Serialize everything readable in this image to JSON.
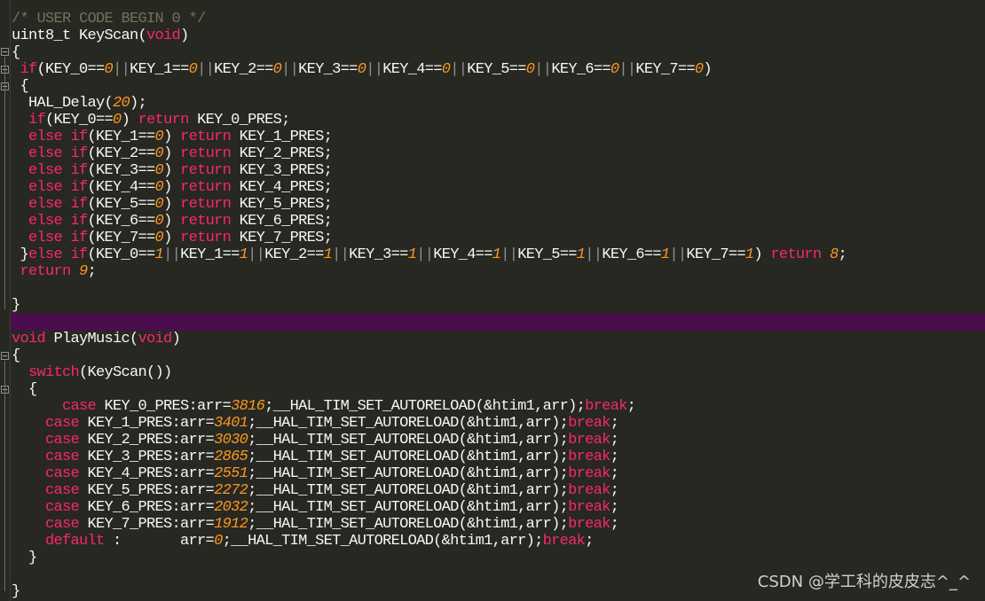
{
  "editor": {
    "lines": [
      [
        {
          "t": "/* USER CODE BEGIN 0 */",
          "c": "cm"
        }
      ],
      [
        {
          "t": "uint8_t KeyScan(",
          "c": "pl"
        },
        {
          "t": "void",
          "c": "kw"
        },
        {
          "t": ")",
          "c": "pl"
        }
      ],
      [
        {
          "t": "{",
          "c": "pl"
        }
      ],
      [
        {
          "t": " ",
          "c": "pl"
        },
        {
          "t": "if",
          "c": "kw"
        },
        {
          "t": "(KEY_0==",
          "c": "pl"
        },
        {
          "t": "0",
          "c": "num"
        },
        {
          "t": "||",
          "c": "sep"
        },
        {
          "t": "KEY_1==",
          "c": "pl"
        },
        {
          "t": "0",
          "c": "num"
        },
        {
          "t": "||",
          "c": "sep"
        },
        {
          "t": "KEY_2==",
          "c": "pl"
        },
        {
          "t": "0",
          "c": "num"
        },
        {
          "t": "||",
          "c": "sep"
        },
        {
          "t": "KEY_3==",
          "c": "pl"
        },
        {
          "t": "0",
          "c": "num"
        },
        {
          "t": "||",
          "c": "sep"
        },
        {
          "t": "KEY_4==",
          "c": "pl"
        },
        {
          "t": "0",
          "c": "num"
        },
        {
          "t": "||",
          "c": "sep"
        },
        {
          "t": "KEY_5==",
          "c": "pl"
        },
        {
          "t": "0",
          "c": "num"
        },
        {
          "t": "||",
          "c": "sep"
        },
        {
          "t": "KEY_6==",
          "c": "pl"
        },
        {
          "t": "0",
          "c": "num"
        },
        {
          "t": "||",
          "c": "sep"
        },
        {
          "t": "KEY_7==",
          "c": "pl"
        },
        {
          "t": "0",
          "c": "num"
        },
        {
          "t": ")",
          "c": "pl"
        }
      ],
      [
        {
          "t": " {",
          "c": "pl"
        }
      ],
      [
        {
          "t": "  HAL_Delay(",
          "c": "pl"
        },
        {
          "t": "20",
          "c": "num"
        },
        {
          "t": ");",
          "c": "pl"
        }
      ],
      [
        {
          "t": "  ",
          "c": "pl"
        },
        {
          "t": "if",
          "c": "kw"
        },
        {
          "t": "(KEY_0==",
          "c": "pl"
        },
        {
          "t": "0",
          "c": "num"
        },
        {
          "t": ") ",
          "c": "pl"
        },
        {
          "t": "return",
          "c": "kw"
        },
        {
          "t": " KEY_0_PRES;",
          "c": "pl"
        }
      ],
      [
        {
          "t": "  ",
          "c": "pl"
        },
        {
          "t": "else if",
          "c": "kw"
        },
        {
          "t": "(KEY_1==",
          "c": "pl"
        },
        {
          "t": "0",
          "c": "num"
        },
        {
          "t": ") ",
          "c": "pl"
        },
        {
          "t": "return",
          "c": "kw"
        },
        {
          "t": " KEY_1_PRES;",
          "c": "pl"
        }
      ],
      [
        {
          "t": "  ",
          "c": "pl"
        },
        {
          "t": "else if",
          "c": "kw"
        },
        {
          "t": "(KEY_2==",
          "c": "pl"
        },
        {
          "t": "0",
          "c": "num"
        },
        {
          "t": ") ",
          "c": "pl"
        },
        {
          "t": "return",
          "c": "kw"
        },
        {
          "t": " KEY_2_PRES;",
          "c": "pl"
        }
      ],
      [
        {
          "t": "  ",
          "c": "pl"
        },
        {
          "t": "else if",
          "c": "kw"
        },
        {
          "t": "(KEY_3==",
          "c": "pl"
        },
        {
          "t": "0",
          "c": "num"
        },
        {
          "t": ") ",
          "c": "pl"
        },
        {
          "t": "return",
          "c": "kw"
        },
        {
          "t": " KEY_3_PRES;",
          "c": "pl"
        }
      ],
      [
        {
          "t": "  ",
          "c": "pl"
        },
        {
          "t": "else if",
          "c": "kw"
        },
        {
          "t": "(KEY_4==",
          "c": "pl"
        },
        {
          "t": "0",
          "c": "num"
        },
        {
          "t": ") ",
          "c": "pl"
        },
        {
          "t": "return",
          "c": "kw"
        },
        {
          "t": " KEY_4_PRES;",
          "c": "pl"
        }
      ],
      [
        {
          "t": "  ",
          "c": "pl"
        },
        {
          "t": "else if",
          "c": "kw"
        },
        {
          "t": "(KEY_5==",
          "c": "pl"
        },
        {
          "t": "0",
          "c": "num"
        },
        {
          "t": ") ",
          "c": "pl"
        },
        {
          "t": "return",
          "c": "kw"
        },
        {
          "t": " KEY_5_PRES;",
          "c": "pl"
        }
      ],
      [
        {
          "t": "  ",
          "c": "pl"
        },
        {
          "t": "else if",
          "c": "kw"
        },
        {
          "t": "(KEY_6==",
          "c": "pl"
        },
        {
          "t": "0",
          "c": "num"
        },
        {
          "t": ") ",
          "c": "pl"
        },
        {
          "t": "return",
          "c": "kw"
        },
        {
          "t": " KEY_6_PRES;",
          "c": "pl"
        }
      ],
      [
        {
          "t": "  ",
          "c": "pl"
        },
        {
          "t": "else if",
          "c": "kw"
        },
        {
          "t": "(KEY_7==",
          "c": "pl"
        },
        {
          "t": "0",
          "c": "num"
        },
        {
          "t": ") ",
          "c": "pl"
        },
        {
          "t": "return",
          "c": "kw"
        },
        {
          "t": " KEY_7_PRES;",
          "c": "pl"
        }
      ],
      [
        {
          "t": " }",
          "c": "pl"
        },
        {
          "t": "else if",
          "c": "kw"
        },
        {
          "t": "(KEY_0==",
          "c": "pl"
        },
        {
          "t": "1",
          "c": "num"
        },
        {
          "t": "||",
          "c": "sep"
        },
        {
          "t": "KEY_1==",
          "c": "pl"
        },
        {
          "t": "1",
          "c": "num"
        },
        {
          "t": "||",
          "c": "sep"
        },
        {
          "t": "KEY_2==",
          "c": "pl"
        },
        {
          "t": "1",
          "c": "num"
        },
        {
          "t": "||",
          "c": "sep"
        },
        {
          "t": "KEY_3==",
          "c": "pl"
        },
        {
          "t": "1",
          "c": "num"
        },
        {
          "t": "||",
          "c": "sep"
        },
        {
          "t": "KEY_4==",
          "c": "pl"
        },
        {
          "t": "1",
          "c": "num"
        },
        {
          "t": "||",
          "c": "sep"
        },
        {
          "t": "KEY_5==",
          "c": "pl"
        },
        {
          "t": "1",
          "c": "num"
        },
        {
          "t": "||",
          "c": "sep"
        },
        {
          "t": "KEY_6==",
          "c": "pl"
        },
        {
          "t": "1",
          "c": "num"
        },
        {
          "t": "||",
          "c": "sep"
        },
        {
          "t": "KEY_7==",
          "c": "pl"
        },
        {
          "t": "1",
          "c": "num"
        },
        {
          "t": ") ",
          "c": "pl"
        },
        {
          "t": "return",
          "c": "kw"
        },
        {
          "t": " ",
          "c": "pl"
        },
        {
          "t": "8",
          "c": "num"
        },
        {
          "t": ";",
          "c": "pl"
        }
      ],
      [
        {
          "t": " ",
          "c": "pl"
        },
        {
          "t": "return",
          "c": "kw"
        },
        {
          "t": " ",
          "c": "pl"
        },
        {
          "t": "9",
          "c": "num"
        },
        {
          "t": ";",
          "c": "pl"
        }
      ],
      [
        {
          "t": "",
          "c": "pl"
        }
      ],
      [
        {
          "t": "}",
          "c": "pl"
        }
      ],
      [
        {
          "t": "",
          "c": "pl"
        }
      ],
      [
        {
          "t": "void",
          "c": "kw"
        },
        {
          "t": " PlayMusic(",
          "c": "pl"
        },
        {
          "t": "void",
          "c": "kw"
        },
        {
          "t": ")",
          "c": "pl"
        }
      ],
      [
        {
          "t": "{",
          "c": "pl"
        }
      ],
      [
        {
          "t": "  ",
          "c": "pl"
        },
        {
          "t": "switch",
          "c": "kw"
        },
        {
          "t": "(KeyScan())",
          "c": "pl"
        }
      ],
      [
        {
          "t": "  {",
          "c": "pl"
        }
      ],
      [
        {
          "t": "      ",
          "c": "pl"
        },
        {
          "t": "case",
          "c": "kw"
        },
        {
          "t": " KEY_0_PRES:arr=",
          "c": "pl"
        },
        {
          "t": "3816",
          "c": "num"
        },
        {
          "t": ";__HAL_TIM_SET_AUTORELOAD(&htim1,arr);",
          "c": "pl"
        },
        {
          "t": "break",
          "c": "kw"
        },
        {
          "t": ";",
          "c": "pl"
        }
      ],
      [
        {
          "t": "    ",
          "c": "pl"
        },
        {
          "t": "case",
          "c": "kw"
        },
        {
          "t": " KEY_1_PRES:arr=",
          "c": "pl"
        },
        {
          "t": "3401",
          "c": "num"
        },
        {
          "t": ";__HAL_TIM_SET_AUTORELOAD(&htim1,arr);",
          "c": "pl"
        },
        {
          "t": "break",
          "c": "kw"
        },
        {
          "t": ";",
          "c": "pl"
        }
      ],
      [
        {
          "t": "    ",
          "c": "pl"
        },
        {
          "t": "case",
          "c": "kw"
        },
        {
          "t": " KEY_2_PRES:arr=",
          "c": "pl"
        },
        {
          "t": "3030",
          "c": "num"
        },
        {
          "t": ";__HAL_TIM_SET_AUTORELOAD(&htim1,arr);",
          "c": "pl"
        },
        {
          "t": "break",
          "c": "kw"
        },
        {
          "t": ";",
          "c": "pl"
        }
      ],
      [
        {
          "t": "    ",
          "c": "pl"
        },
        {
          "t": "case",
          "c": "kw"
        },
        {
          "t": " KEY_3_PRES:arr=",
          "c": "pl"
        },
        {
          "t": "2865",
          "c": "num"
        },
        {
          "t": ";__HAL_TIM_SET_AUTORELOAD(&htim1,arr);",
          "c": "pl"
        },
        {
          "t": "break",
          "c": "kw"
        },
        {
          "t": ";",
          "c": "pl"
        }
      ],
      [
        {
          "t": "    ",
          "c": "pl"
        },
        {
          "t": "case",
          "c": "kw"
        },
        {
          "t": " KEY_4_PRES:arr=",
          "c": "pl"
        },
        {
          "t": "2551",
          "c": "num"
        },
        {
          "t": ";__HAL_TIM_SET_AUTORELOAD(&htim1,arr);",
          "c": "pl"
        },
        {
          "t": "break",
          "c": "kw"
        },
        {
          "t": ";",
          "c": "pl"
        }
      ],
      [
        {
          "t": "    ",
          "c": "pl"
        },
        {
          "t": "case",
          "c": "kw"
        },
        {
          "t": " KEY_5_PRES:arr=",
          "c": "pl"
        },
        {
          "t": "2272",
          "c": "num"
        },
        {
          "t": ";__HAL_TIM_SET_AUTORELOAD(&htim1,arr);",
          "c": "pl"
        },
        {
          "t": "break",
          "c": "kw"
        },
        {
          "t": ";",
          "c": "pl"
        }
      ],
      [
        {
          "t": "    ",
          "c": "pl"
        },
        {
          "t": "case",
          "c": "kw"
        },
        {
          "t": " KEY_6_PRES:arr=",
          "c": "pl"
        },
        {
          "t": "2032",
          "c": "num"
        },
        {
          "t": ";__HAL_TIM_SET_AUTORELOAD(&htim1,arr);",
          "c": "pl"
        },
        {
          "t": "break",
          "c": "kw"
        },
        {
          "t": ";",
          "c": "pl"
        }
      ],
      [
        {
          "t": "    ",
          "c": "pl"
        },
        {
          "t": "case",
          "c": "kw"
        },
        {
          "t": " KEY_7_PRES:arr=",
          "c": "pl"
        },
        {
          "t": "1912",
          "c": "num"
        },
        {
          "t": ";__HAL_TIM_SET_AUTORELOAD(&htim1,arr);",
          "c": "pl"
        },
        {
          "t": "break",
          "c": "kw"
        },
        {
          "t": ";",
          "c": "pl"
        }
      ],
      [
        {
          "t": "    ",
          "c": "pl"
        },
        {
          "t": "default",
          "c": "kw"
        },
        {
          "t": " :       arr=",
          "c": "pl"
        },
        {
          "t": "0",
          "c": "num"
        },
        {
          "t": ";__HAL_TIM_SET_AUTORELOAD(&htim1,arr);",
          "c": "pl"
        },
        {
          "t": "break",
          "c": "kw"
        },
        {
          "t": ";",
          "c": "pl"
        }
      ],
      [
        {
          "t": "  }",
          "c": "pl"
        }
      ],
      [
        {
          "t": "",
          "c": "pl"
        }
      ],
      [
        {
          "t": "}",
          "c": "pl"
        }
      ]
    ],
    "highlighted_line": 18
  },
  "colors": {
    "background": "#272822",
    "keyword": "#f92672",
    "number": "#fd971f",
    "comment": "#75715e",
    "current_line": "#4a0e4e"
  },
  "watermark": "CSDN @学工科的皮皮志^_^"
}
